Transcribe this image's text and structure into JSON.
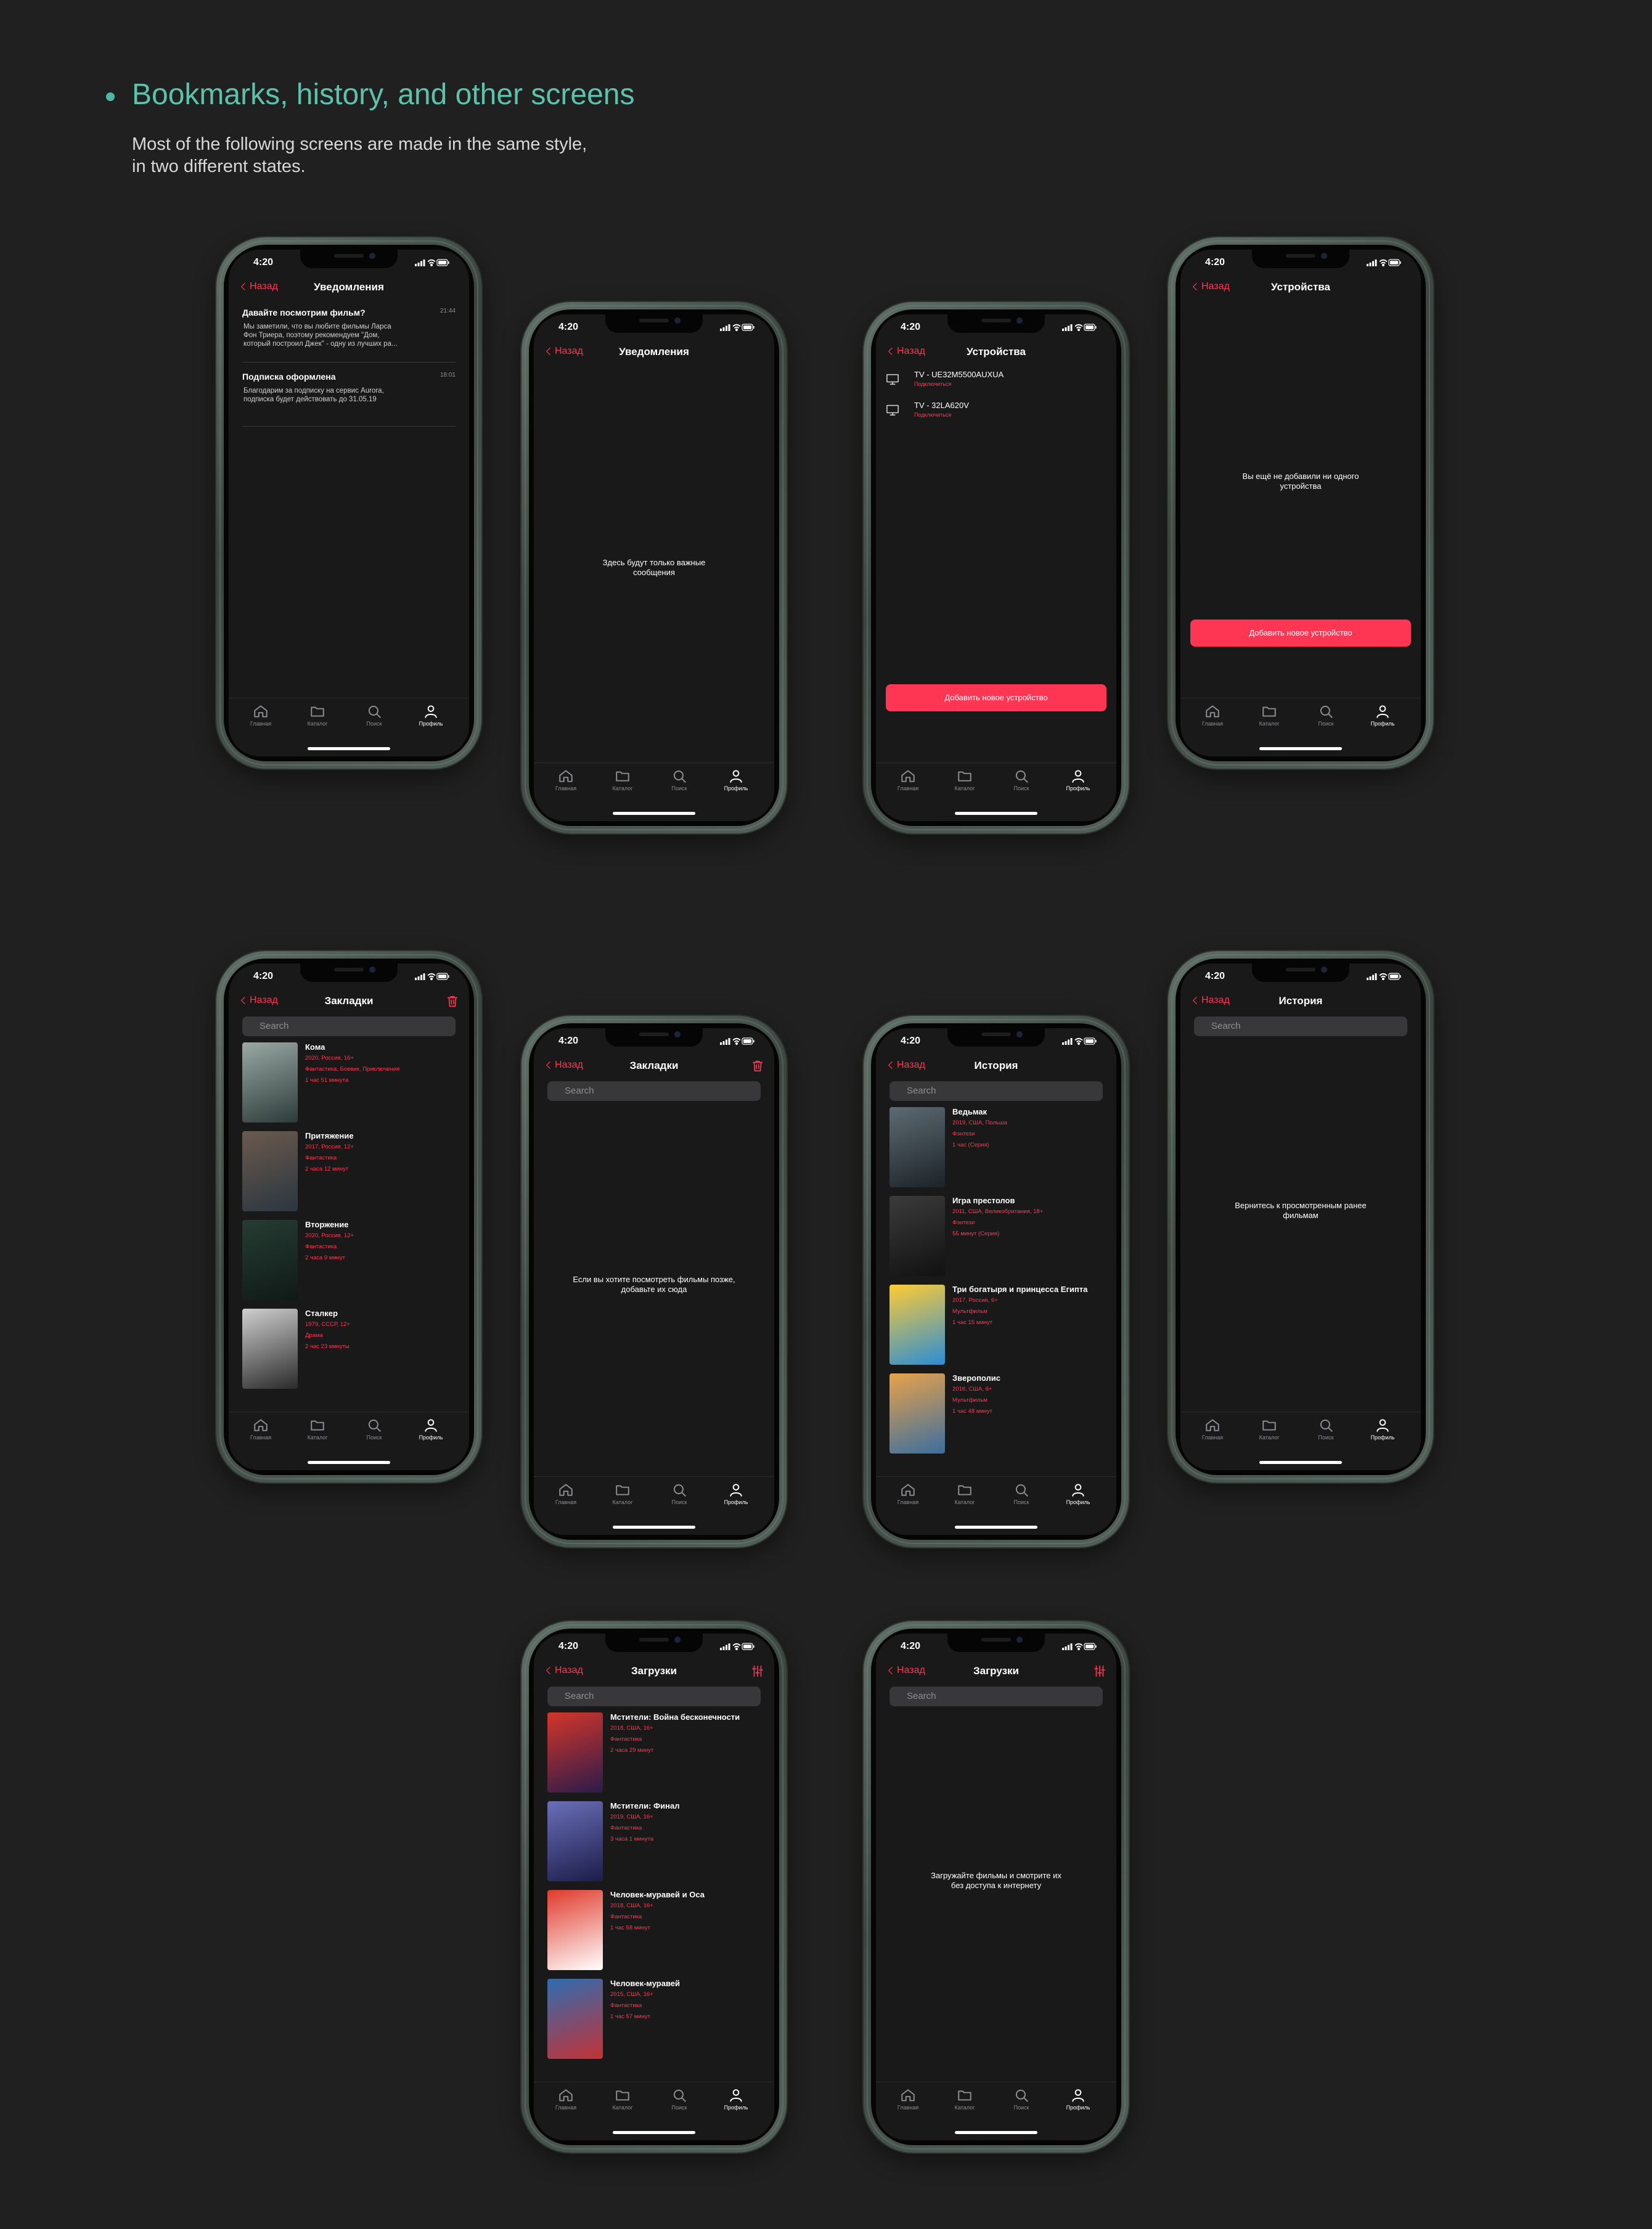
{
  "header": {
    "title": "Bookmarks, history, and other screens",
    "subtitle": "Most of the following screens are made in the same style,\nin two different states."
  },
  "common": {
    "time": "4:20",
    "back": "Назад",
    "search_placeholder": "Search",
    "tabs": [
      "Главная",
      "Каталог",
      "Поиск",
      "Профиль"
    ],
    "accent": "#ff3554",
    "heading_color": "#5cc2ac"
  },
  "phones": {
    "p1": {
      "title": "Уведомления",
      "notifications": [
        {
          "title": "Давайте посмотрим фильм?",
          "time": "21:44",
          "body": "Мы заметили, что вы любите фильмы Ларса\nФон Триера, поэтому рекомендуем \"Дом,\nкоторый построил Джек\" - одну из лучших ра..."
        },
        {
          "title": "Подписка оформлена",
          "time": "18:01",
          "body": "Благодарим за подписку на сервис Aurora,\nподписка будет действовать до 31.05.19"
        }
      ]
    },
    "p2": {
      "title": "Уведомления",
      "empty": "Здесь будут только важные\nсообщения"
    },
    "p3": {
      "title": "Устройства",
      "devices": [
        {
          "name": "TV - UE32M5500AUXUA",
          "status": "Подключиться"
        },
        {
          "name": "TV - 32LA620V",
          "status": "Подключиться"
        }
      ],
      "button": "Добавить новое устройство"
    },
    "p4": {
      "title": "Устройства",
      "empty": "Вы ещё не добавили ни одного\nустройства",
      "button": "Добавить новое устройство"
    },
    "p5": {
      "title": "Закладки",
      "movies": [
        {
          "title": "Кома",
          "l1": "2020, Россия, 16+",
          "l2": "Фантастика, Боевик, Приключения",
          "l3": "1 час 51 минута"
        },
        {
          "title": "Притяжение",
          "l1": "2017, Россия, 12+",
          "l2": "Фантастика",
          "l3": "2 часа 12 минут"
        },
        {
          "title": "Вторжение",
          "l1": "2020, Россия, 12+",
          "l2": "Фантастика",
          "l3": "2 часа 9 минут"
        },
        {
          "title": "Сталкер",
          "l1": "1979, СССР, 12+",
          "l2": "Драма",
          "l3": "2 час 23 минуты"
        }
      ]
    },
    "p6": {
      "title": "Закладки",
      "empty": "Если вы хотите посмотреть фильмы позже,\nдобавьте их сюда"
    },
    "p7": {
      "title": "История",
      "movies": [
        {
          "title": "Ведьмак",
          "l1": "2019, США, Польша",
          "l2": "Фэнтези",
          "l3": "1 час (Серия)"
        },
        {
          "title": "Игра престолов",
          "l1": "2011, США, Великобритания, 18+",
          "l2": "Фэнтези",
          "l3": "55 минут (Серия)"
        },
        {
          "title": "Три богатыря и принцесса Египта",
          "l1": "2017, Россия, 6+",
          "l2": "Мультфильм",
          "l3": "1 час 15 минут"
        },
        {
          "title": "Зверополис",
          "l1": "2016, США, 6+",
          "l2": "Мультфильм",
          "l3": "1 час 48 минут"
        }
      ]
    },
    "p8": {
      "title": "История",
      "empty": "Вернитесь к просмотренным ранее фильмам"
    },
    "p9": {
      "title": "Загрузки",
      "movies": [
        {
          "title": "Мстители: Война бесконечности",
          "l1": "2018, США, 16+",
          "l2": "Фантастика",
          "l3": "2 часа 29 минут"
        },
        {
          "title": "Мстители: Финал",
          "l1": "2019, США, 16+",
          "l2": "Фантастика",
          "l3": "3 часа 1 минута"
        },
        {
          "title": "Человек-муравей и Оса",
          "l1": "2018, США, 16+",
          "l2": "Фантастика",
          "l3": "1 час 58 минут"
        },
        {
          "title": "Человек-муравей",
          "l1": "2015, США, 16+",
          "l2": "Фантастика",
          "l3": "1 час 57 минут"
        }
      ]
    },
    "p10": {
      "title": "Загрузки",
      "empty": "Загружайте фильмы и смотрите их\nбез доступа к интернету"
    }
  }
}
